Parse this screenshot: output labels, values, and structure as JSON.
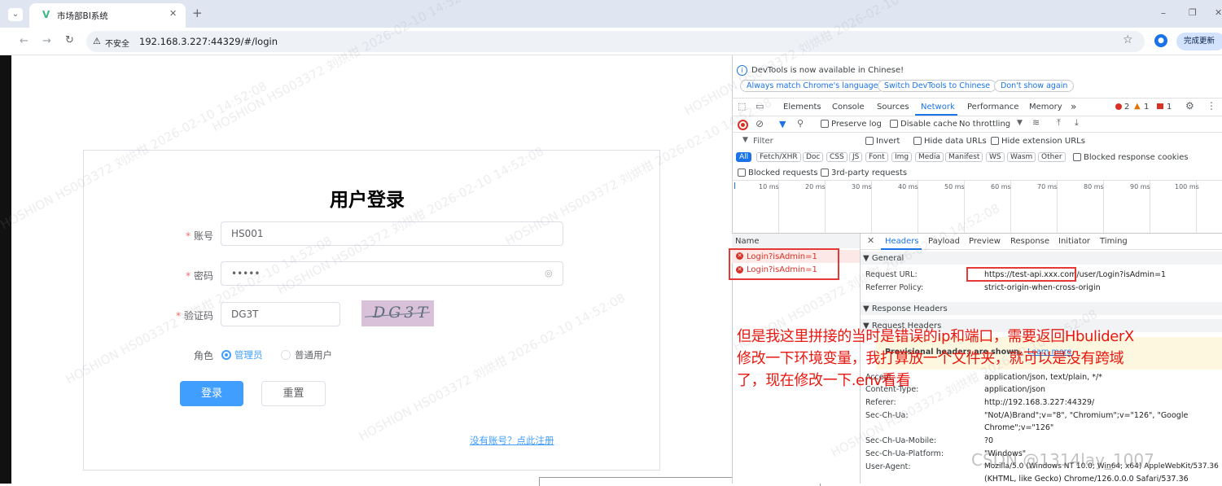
{
  "browser": {
    "tab_title": "市场部BI系统",
    "new_tab": "+",
    "insecure_label": "不安全",
    "url": "192.168.3.227:44329/#/login",
    "update_button": "完成更新",
    "window_controls": [
      "–",
      "❐",
      "✕"
    ]
  },
  "login": {
    "title": "用户登录",
    "account_label": "账号",
    "account_value": "HS001",
    "password_label": "密码",
    "password_value": "•••••",
    "captcha_label": "验证码",
    "captcha_value": "DG3T",
    "captcha_image_text": "DG3T",
    "role_label": "角色",
    "role_admin": "管理员",
    "role_user": "普通用户",
    "login_button": "登录",
    "reset_button": "重置",
    "register_link": "没有账号？点此注册",
    "required_mark": "*"
  },
  "devtools": {
    "info_text": "DevTools is now available in Chinese!",
    "info_buttons": [
      "Always match Chrome's language",
      "Switch DevTools to Chinese",
      "Don't show again"
    ],
    "tabs": [
      "Elements",
      "Console",
      "Sources",
      "Network",
      "Performance",
      "Memory"
    ],
    "active_tab": "Network",
    "more_tabs": "»",
    "error_count": "2",
    "warning_count": "1",
    "issue_count": "1",
    "preserve_log": "Preserve log",
    "disable_cache": "Disable cache",
    "throttling": "No throttling",
    "filter_placeholder": "Filter",
    "invert": "Invert",
    "hide_data_urls": "Hide data URLs",
    "hide_extension_urls": "Hide extension URLs",
    "type_chips": [
      "All",
      "Fetch/XHR",
      "Doc",
      "CSS",
      "JS",
      "Font",
      "Img",
      "Media",
      "Manifest",
      "WS",
      "Wasm",
      "Other"
    ],
    "blocked_response_cookies": "Blocked response cookies",
    "blocked_requests": "Blocked requests",
    "third_party_requests": "3rd-party requests",
    "timeline_ticks": [
      "10 ms",
      "20 ms",
      "30 ms",
      "40 ms",
      "50 ms",
      "60 ms",
      "70 ms",
      "80 ms",
      "90 ms",
      "100 ms"
    ],
    "name_header": "Name",
    "requests": [
      "Login?isAdmin=1",
      "Login?isAdmin=1"
    ],
    "detail_tabs": [
      "Headers",
      "Payload",
      "Preview",
      "Response",
      "Initiator",
      "Timing"
    ],
    "active_detail_tab": "Headers",
    "general_section": "▼ General",
    "request_url_label": "Request URL:",
    "request_url_value": "https://test-api.xxx.com/user/Login?isAdmin=1",
    "referrer_policy_label": "Referrer Policy:",
    "referrer_policy_value": "strict-origin-when-cross-origin",
    "response_headers_section": "▼ Response Headers",
    "request_headers_section": "▼ Request Headers",
    "provisional_warning": "Provisional headers are shown.",
    "learn_more": "Learn more",
    "request_headers": [
      {
        "name": "Accept:",
        "value": "application/json, text/plain, */*"
      },
      {
        "name": "Content-Type:",
        "value": "application/json"
      },
      {
        "name": "Referer:",
        "value": "http://192.168.3.227:44329/"
      },
      {
        "name": "Sec-Ch-Ua:",
        "value": "\"Not/A)Brand\";v=\"8\", \"Chromium\";v=\"126\", \"Google"
      },
      {
        "name": "",
        "value": "Chrome\";v=\"126\""
      },
      {
        "name": "Sec-Ch-Ua-Mobile:",
        "value": "?0"
      },
      {
        "name": "Sec-Ch-Ua-Platform:",
        "value": "\"Windows\""
      },
      {
        "name": "User-Agent:",
        "value": "Mozilla/5.0 (Windows NT 10.0; Win64; x64) AppleWebKit/537.36"
      },
      {
        "name": "",
        "value": "(KHTML, like Gecko) Chrome/126.0.0.0 Safari/537.36"
      }
    ]
  },
  "annotation": {
    "lines": [
      "但是我这里拼接的当时是错误的ip和端口，需要返回HbuliderX",
      "修改一下环境变量，我打算放一个文件夹，就可以是没有跨域",
      "了，现在修改一下.env看看"
    ],
    "color": "#e8170f"
  },
  "watermark": {
    "text": "HOSHION HS003372 刘烘柑 2026-02-10 14:52:08",
    "csdn": "CSDN @1314lay_1007"
  },
  "colors": {
    "primary": "#409eff",
    "devtools_blue": "#1a73e8",
    "error_red": "#d93025"
  }
}
